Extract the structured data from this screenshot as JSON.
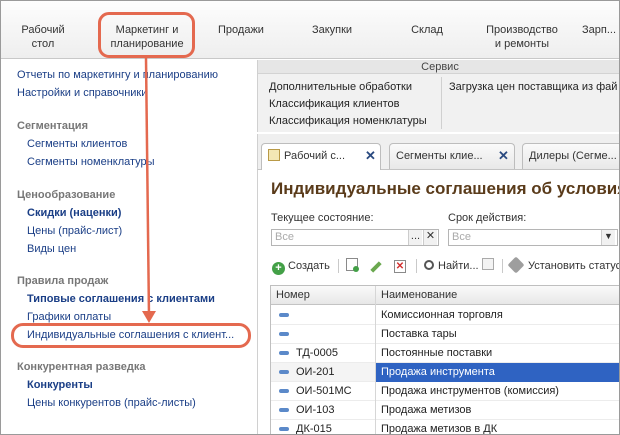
{
  "sections": {
    "desktop": "Рабочий\nстол",
    "marketing": "Маркетинг и\nпланирование",
    "sales": "Продажи",
    "purchases": "Закупки",
    "warehouse": "Склад",
    "production": "Производство\nи ремонты",
    "salary": "Зарп..."
  },
  "leftnav": {
    "top_links": [
      "Отчеты по маркетингу и планированию",
      "Настройки и справочники"
    ],
    "groups": [
      {
        "title": "Сегментация",
        "items": [
          "Сегменты клиентов",
          "Сегменты номенклатуры"
        ]
      },
      {
        "title": "Ценообразование",
        "items": [
          "Скидки (наценки)",
          "Цены (прайс-лист)",
          "Виды цен"
        ]
      },
      {
        "title": "Правила продаж",
        "items": [
          "Типовые соглашения с клиентами",
          "Графики оплаты",
          "Индивидуальные соглашения с клиент..."
        ]
      },
      {
        "title": "Конкурентная разведка",
        "items": [
          "Конкуренты",
          "Цены конкурентов (прайс-листы)"
        ]
      }
    ]
  },
  "service": {
    "title": "Сервис",
    "left": [
      "Дополнительные обработки",
      "Классификация клиентов",
      "Классификация номенклатуры"
    ],
    "right": [
      "Загрузка цен поставщика из фай"
    ]
  },
  "tabs": [
    {
      "label": "Рабочий с...",
      "close": "✕"
    },
    {
      "label": "Сегменты клие...",
      "close": "✕"
    },
    {
      "label": "Дилеры (Сегме..."
    }
  ],
  "document": {
    "title": "Индивидуальные соглашения об условия",
    "state_label": "Текущее состояние:",
    "state_placeholder": "Все",
    "term_label": "Срок действия:",
    "term_placeholder": "Все"
  },
  "toolbar": {
    "create": "Создать",
    "find": "Найти...",
    "set_status": "Установить статус"
  },
  "grid": {
    "columns": [
      "Номер",
      "Наименование"
    ],
    "rows": [
      {
        "number": "",
        "name": "Комиссионная торговля"
      },
      {
        "number": "",
        "name": "Поставка тары"
      },
      {
        "number": "ТД-0005",
        "name": "Постоянные поставки"
      },
      {
        "number": "ОИ-201",
        "name": "Продажа инструмента",
        "selected": true
      },
      {
        "number": "ОИ-501МС",
        "name": "Продажа инструментов (комиссия)"
      },
      {
        "number": "ОИ-103",
        "name": "Продажа метизов"
      },
      {
        "number": "ДК-015",
        "name": "Продажа метизов в ДК"
      }
    ]
  },
  "colors": {
    "highlight": "#e4694f",
    "link": "#1a3e86",
    "selection": "#2f63c2",
    "title": "#5a3b1a"
  }
}
